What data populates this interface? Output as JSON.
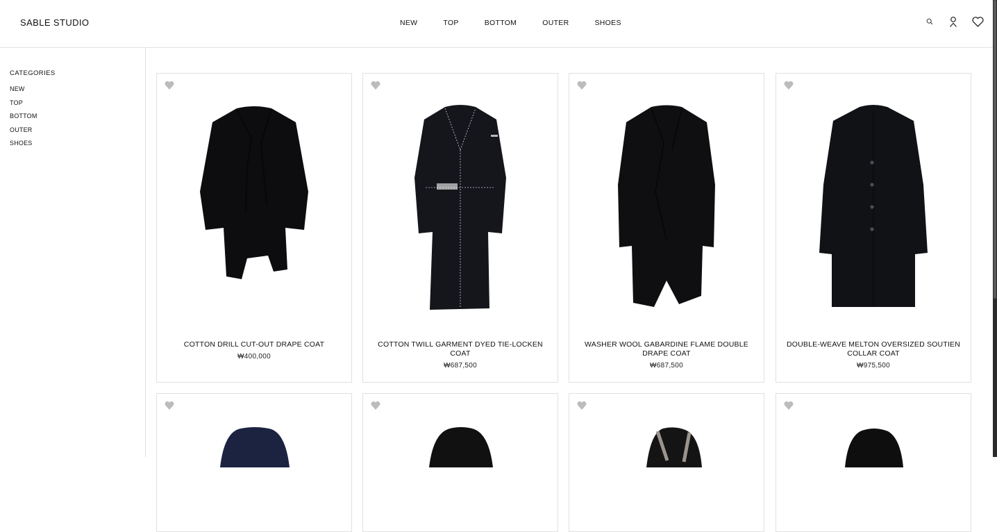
{
  "brand": "SABLE STUDIO",
  "nav": [
    "NEW",
    "TOP",
    "BOTTOM",
    "OUTER",
    "SHOES"
  ],
  "header_icons": [
    "search-icon",
    "user-icon",
    "heart-icon"
  ],
  "sidebar": {
    "title": "CATEGORIES",
    "items": [
      "NEW",
      "TOP",
      "BOTTOM",
      "OUTER",
      "SHOES"
    ]
  },
  "products": [
    {
      "name": "COTTON DRILL CUT-OUT DRAPE COAT",
      "price": "₩400,000",
      "color": "#0d0d0f"
    },
    {
      "name": "COTTON TWILL GARMENT DYED TIE-LOCKEN COAT",
      "price": "₩687,500",
      "color": "#14161c"
    },
    {
      "name": "WASHER WOOL GABARDINE FLAME DOUBLE DRAPE COAT",
      "price": "₩687,500",
      "color": "#0f0f11"
    },
    {
      "name": "DOUBLE-WEAVE MELTON OVERSIZED SOUTIEN COLLAR COAT",
      "price": "₩975,500",
      "color": "#101216"
    },
    {
      "name": "",
      "price": "",
      "color": "#1b2340"
    },
    {
      "name": "",
      "price": "",
      "color": "#111111"
    },
    {
      "name": "",
      "price": "",
      "color": "#141414"
    },
    {
      "name": "",
      "price": "",
      "color": "#0e0e0e"
    }
  ]
}
